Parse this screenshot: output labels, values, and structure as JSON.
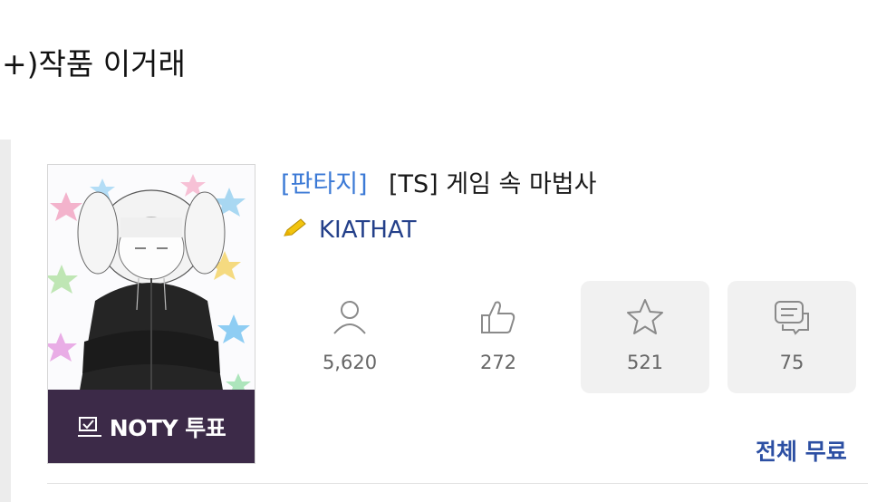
{
  "heading": "+)작품 이거래",
  "novel": {
    "genre": "[판타지]",
    "title": "[TS] 게임 속 마법사",
    "author": "KIATHAT",
    "noty_vote_label": "NOTY 투표",
    "price_label": "전체 무료"
  },
  "stats": [
    {
      "icon": "person-icon",
      "value": "5,620"
    },
    {
      "icon": "thumbs-up-icon",
      "value": "272"
    },
    {
      "icon": "star-icon",
      "value": "521"
    },
    {
      "icon": "comment-icon",
      "value": "75"
    }
  ],
  "colors": {
    "genre": "#3c7ad6",
    "author": "#24408a",
    "noty_bg": "#3c2a48",
    "stat_bg": "#f1f1f1",
    "pencil": "#f2c40f"
  }
}
